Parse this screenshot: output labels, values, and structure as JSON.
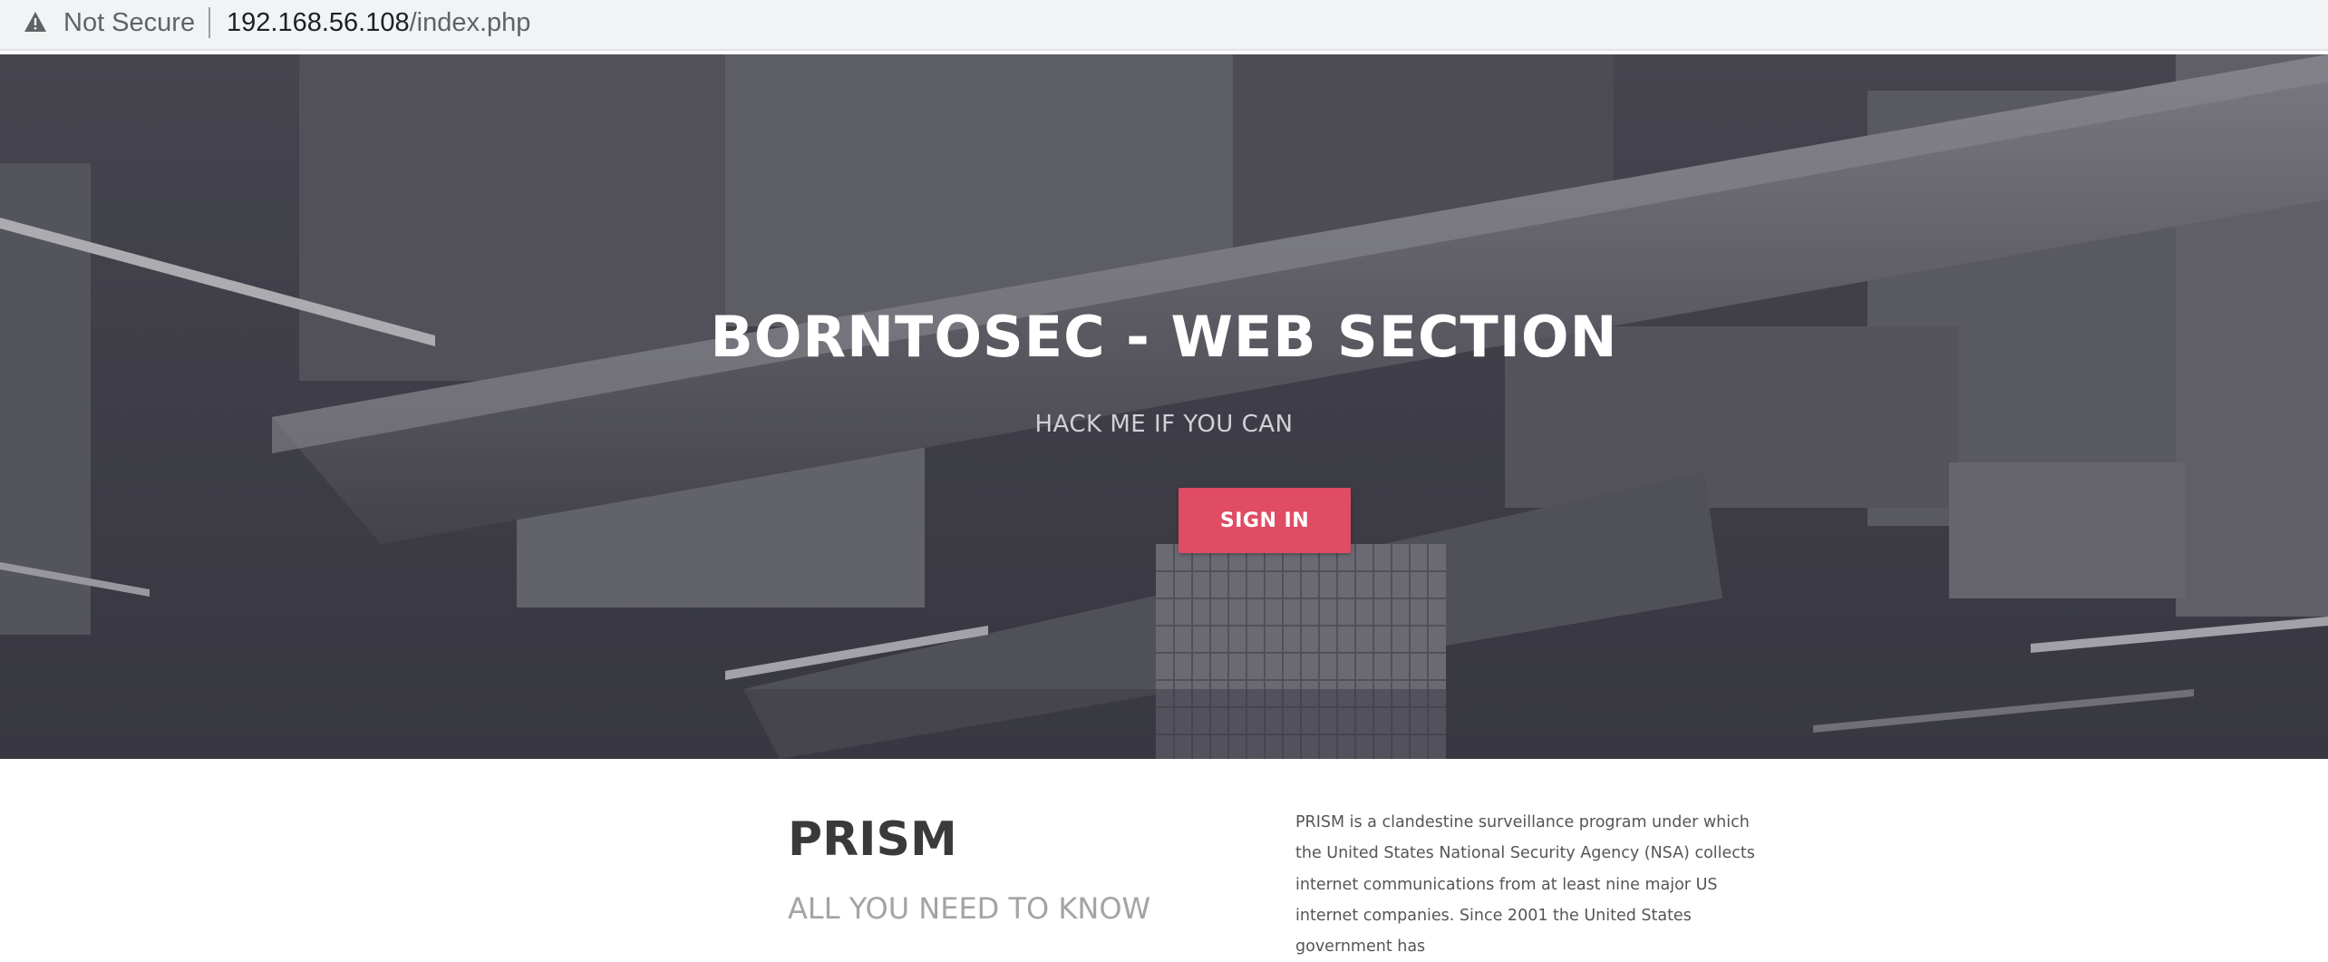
{
  "browser": {
    "security_label": "Not Secure",
    "url_host": "192.168.56.108",
    "url_path": "/index.php"
  },
  "hero": {
    "title": "BORNTOSEC - WEB SECTION",
    "subtitle": "HACK ME IF YOU CAN",
    "signin_label": "SIGN IN"
  },
  "section": {
    "title": "PRISM",
    "subtitle": "ALL YOU NEED TO KNOW",
    "paragraph": "PRISM is a clandestine surveillance program under which the United States National Security Agency (NSA) collects internet communications from at least nine major US internet companies. Since 2001 the United States government has"
  },
  "colors": {
    "accent": "#e04c64",
    "hero_bg": "#44434c",
    "title_text": "#3a3a3a",
    "muted_text": "#a3a3a8"
  }
}
